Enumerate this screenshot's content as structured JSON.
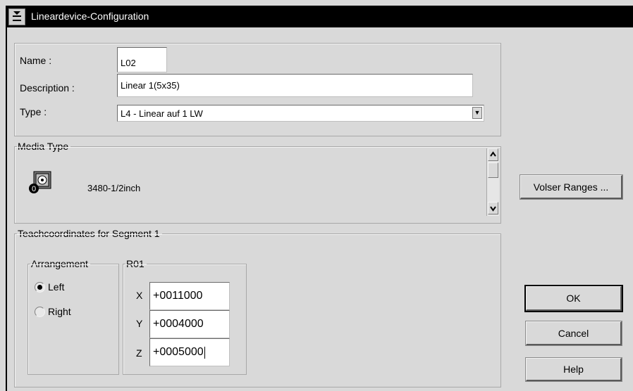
{
  "window": {
    "title": "Lineardevice-Configuration"
  },
  "general": {
    "name_label": "Name :",
    "name_value": "L02",
    "description_label": "Description :",
    "description_value": "Linear 1(5x35)",
    "type_label": "Type :",
    "type_value": "L4  -  Linear auf 1 LW"
  },
  "media": {
    "legend": "Media Type",
    "item_label": "3480-1/2inch",
    "icon": "tape-cartridge-icon"
  },
  "teach": {
    "legend": "Teachcoordinates for Segment 1",
    "arrangement": {
      "legend": "Arrangement",
      "left_label": "Left",
      "right_label": "Right",
      "selected": "Left"
    },
    "r01": {
      "legend": "R01",
      "x_label": "X",
      "x_value": "+0011000",
      "y_label": "Y",
      "y_value": "+0004000",
      "z_label": "Z",
      "z_value": "+0005000"
    }
  },
  "buttons": {
    "volser": "Volser Ranges ...",
    "ok": "OK",
    "cancel": "Cancel",
    "help": "Help"
  }
}
